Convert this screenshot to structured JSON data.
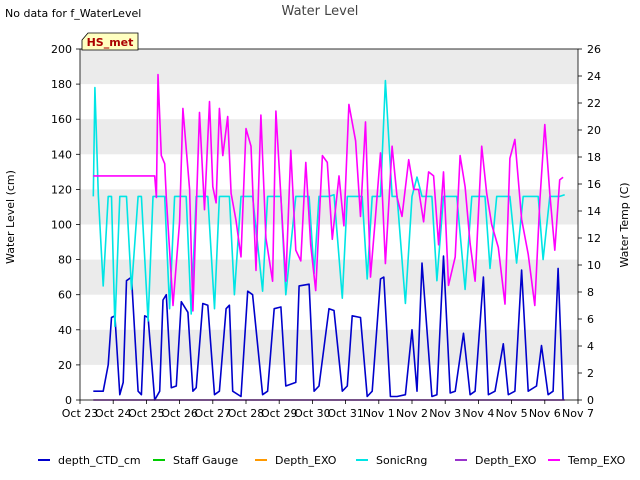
{
  "note": "No data for f_WaterLevel",
  "chart_data": {
    "type": "line",
    "title": "Water Level",
    "station_tag": "HS_met",
    "ylabel": "Water Level (cm)",
    "y2label": "Water Temp (C)",
    "x_ticks": [
      "Oct 23",
      "Oct 24",
      "Oct 25",
      "Oct 26",
      "Oct 27",
      "Oct 28",
      "Oct 29",
      "Oct 30",
      "Oct 31",
      "Nov 1",
      "Nov 2",
      "Nov 3",
      "Nov 4",
      "Nov 5",
      "Nov 6",
      "Nov 7"
    ],
    "xlim": [
      0,
      15
    ],
    "ylim": [
      0,
      200
    ],
    "y_ticks": [
      0,
      20,
      40,
      60,
      80,
      100,
      120,
      140,
      160,
      180,
      200
    ],
    "y2lim": [
      0,
      26
    ],
    "y2_ticks": [
      0,
      2,
      4,
      6,
      8,
      10,
      12,
      14,
      16,
      18,
      20,
      22,
      24,
      26
    ],
    "grid": "horizontal bands",
    "legend_position": "bottom",
    "series": [
      {
        "name": "depth_CTD_cm",
        "color": "#0000cc",
        "axis": "left",
        "x": [
          0.4,
          0.7,
          0.85,
          0.95,
          1.05,
          1.2,
          1.3,
          1.4,
          1.55,
          1.75,
          1.85,
          1.95,
          2.05,
          2.25,
          2.4,
          2.5,
          2.6,
          2.75,
          2.9,
          3.05,
          3.25,
          3.4,
          3.5,
          3.7,
          3.85,
          4.05,
          4.2,
          4.4,
          4.5,
          4.6,
          4.85,
          5.05,
          5.2,
          5.5,
          5.65,
          5.85,
          6.05,
          6.2,
          6.5,
          6.6,
          6.9,
          7.05,
          7.2,
          7.5,
          7.65,
          7.9,
          8.05,
          8.2,
          8.45,
          8.65,
          8.8,
          9.05,
          9.15,
          9.35,
          9.5,
          9.55,
          9.8,
          10.0,
          10.15,
          10.3,
          10.6,
          10.75,
          10.95,
          11.15,
          11.3,
          11.55,
          11.75,
          11.9,
          12.15,
          12.3,
          12.5,
          12.75,
          12.9,
          13.1,
          13.3,
          13.5,
          13.75,
          13.9,
          14.1,
          14.25,
          14.4,
          14.55
        ],
        "y": [
          5,
          5,
          20,
          47,
          48,
          3,
          10,
          68,
          70,
          5,
          3,
          48,
          47,
          0,
          5,
          57,
          60,
          7,
          8,
          56,
          50,
          5,
          7,
          55,
          54,
          3,
          5,
          52,
          54,
          5,
          2,
          62,
          60,
          3,
          5,
          52,
          53,
          8,
          10,
          65,
          66,
          5,
          8,
          52,
          51,
          5,
          8,
          48,
          47,
          2,
          5,
          69,
          70,
          2,
          2,
          2,
          3,
          40,
          5,
          78,
          2,
          3,
          82,
          4,
          5,
          38,
          3,
          5,
          70,
          3,
          5,
          32,
          3,
          5,
          74,
          5,
          8,
          31,
          3,
          5,
          75,
          0
        ]
      },
      {
        "name": "Staff Gauge",
        "color": "#00cc00",
        "axis": "left",
        "x": [],
        "y": []
      },
      {
        "name": "Depth_EXO",
        "color": "#ff9900",
        "axis": "left",
        "x": [],
        "y": []
      },
      {
        "name": "SonicRng",
        "color": "#00e5e5",
        "axis": "left",
        "x": [
          0.4,
          0.45,
          0.55,
          0.7,
          0.85,
          0.95,
          1.05,
          1.2,
          1.3,
          1.4,
          1.55,
          1.75,
          1.85,
          2.05,
          2.2,
          2.4,
          2.55,
          2.7,
          2.85,
          3.0,
          3.2,
          3.35,
          3.5,
          3.7,
          3.85,
          4.05,
          4.2,
          4.4,
          4.5,
          4.65,
          4.85,
          5.05,
          5.2,
          5.5,
          5.65,
          5.85,
          6.05,
          6.2,
          6.5,
          6.6,
          6.9,
          7.05,
          7.2,
          7.5,
          7.65,
          7.9,
          8.05,
          8.2,
          8.5,
          8.65,
          8.8,
          9.05,
          9.2,
          9.4,
          9.5,
          9.55,
          9.8,
          10.0,
          10.15,
          10.3,
          10.6,
          10.75,
          10.95,
          11.2,
          11.35,
          11.6,
          11.8,
          11.95,
          12.2,
          12.35,
          12.55,
          12.8,
          12.95,
          13.15,
          13.35,
          13.55,
          13.8,
          13.95,
          14.15,
          14.3,
          14.45,
          14.6
        ],
        "y": [
          116,
          178,
          117,
          65,
          116,
          116,
          42,
          116,
          116,
          116,
          63,
          116,
          116,
          45,
          116,
          116,
          116,
          52,
          116,
          116,
          116,
          49,
          116,
          116,
          116,
          52,
          116,
          116,
          116,
          60,
          116,
          116,
          116,
          62,
          116,
          116,
          116,
          60,
          116,
          116,
          116,
          72,
          116,
          116,
          117,
          58,
          116,
          116,
          116,
          69,
          116,
          116,
          182,
          116,
          116,
          116,
          55,
          116,
          127,
          116,
          116,
          68,
          116,
          116,
          116,
          63,
          116,
          116,
          116,
          75,
          116,
          116,
          116,
          78,
          116,
          116,
          116,
          80,
          116,
          116,
          116,
          117
        ]
      },
      {
        "name": "Depth_EXO",
        "color": "#9933cc",
        "axis": "left",
        "x": [
          0.4,
          2.4,
          2.45,
          14.6
        ],
        "y": [
          0,
          0,
          0,
          0
        ]
      },
      {
        "name": "Temp_EXO",
        "color": "#ff00ff",
        "axis": "right",
        "x": [
          0.4,
          2.25,
          2.3,
          2.35,
          2.45,
          2.55,
          2.6,
          2.8,
          3.0,
          3.1,
          3.3,
          3.4,
          3.6,
          3.75,
          3.9,
          4.0,
          4.1,
          4.2,
          4.3,
          4.45,
          4.55,
          4.7,
          4.85,
          5.0,
          5.15,
          5.3,
          5.45,
          5.6,
          5.8,
          5.9,
          6.1,
          6.2,
          6.35,
          6.5,
          6.65,
          6.8,
          6.95,
          7.1,
          7.3,
          7.45,
          7.6,
          7.8,
          7.95,
          8.1,
          8.3,
          8.45,
          8.6,
          8.75,
          8.9,
          9.05,
          9.2,
          9.4,
          9.55,
          9.7,
          9.9,
          10.05,
          10.2,
          10.35,
          10.5,
          10.65,
          10.8,
          10.95,
          11.1,
          11.3,
          11.45,
          11.6,
          11.75,
          11.9,
          12.1,
          12.25,
          12.4,
          12.6,
          12.8,
          12.95,
          13.1,
          13.3,
          13.5,
          13.7,
          13.85,
          14.0,
          14.15,
          14.3,
          14.45,
          14.55
        ],
        "y": [
          16.6,
          16.6,
          15.0,
          24.1,
          18.1,
          17.5,
          15.0,
          7.0,
          13.2,
          21.6,
          15.6,
          6.6,
          21.3,
          14.1,
          22.1,
          15.8,
          14.6,
          21.6,
          18.1,
          21.0,
          15.3,
          13.3,
          10.6,
          20.1,
          18.8,
          9.6,
          21.1,
          12.0,
          8.8,
          21.4,
          13.0,
          8.8,
          18.5,
          11.1,
          10.3,
          17.6,
          11.5,
          8.1,
          18.1,
          17.6,
          11.9,
          16.6,
          12.9,
          21.9,
          19.2,
          13.6,
          20.6,
          9.1,
          13.6,
          18.3,
          10.1,
          18.8,
          15.0,
          13.6,
          17.8,
          15.6,
          15.6,
          13.2,
          16.9,
          16.6,
          11.5,
          16.9,
          8.5,
          10.6,
          18.1,
          15.8,
          11.6,
          8.8,
          18.8,
          15.3,
          13.0,
          11.3,
          7.1,
          17.9,
          19.3,
          13.4,
          10.8,
          7.0,
          14.7,
          20.4,
          15.3,
          11.1,
          16.3,
          16.5
        ]
      }
    ]
  }
}
